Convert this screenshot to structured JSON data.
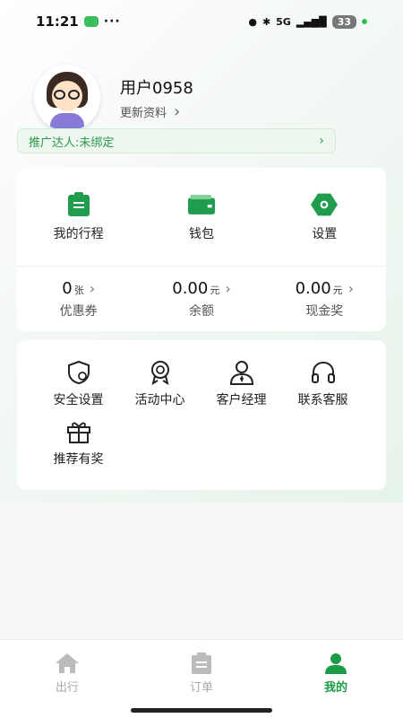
{
  "status_bar": {
    "time": "11:21",
    "dots": "···",
    "network": "5G",
    "battery": "33"
  },
  "profile": {
    "username": "用户0958",
    "edit_label": "更新资料",
    "avatar_icon": "user-avatar"
  },
  "promo": {
    "label": "推广达人:未绑定"
  },
  "quick_actions": [
    {
      "label": "我的行程",
      "icon": "clipboard-icon"
    },
    {
      "label": "钱包",
      "icon": "wallet-icon"
    },
    {
      "label": "设置",
      "icon": "gear-icon"
    }
  ],
  "stats": [
    {
      "value": "0",
      "unit": "张",
      "label": "优惠券"
    },
    {
      "value": "0.00",
      "unit": "元",
      "label": "余额"
    },
    {
      "value": "0.00",
      "unit": "元",
      "label": "现金奖"
    }
  ],
  "services": [
    {
      "label": "安全设置",
      "icon": "shield-gear-icon"
    },
    {
      "label": "活动中心",
      "icon": "medal-icon"
    },
    {
      "label": "客户经理",
      "icon": "manager-icon"
    },
    {
      "label": "联系客服",
      "icon": "headset-icon"
    },
    {
      "label": "推荐有奖",
      "icon": "gift-icon"
    }
  ],
  "tabbar": [
    {
      "label": "出行",
      "icon": "home-icon",
      "active": false
    },
    {
      "label": "订单",
      "icon": "orders-icon",
      "active": false
    },
    {
      "label": "我的",
      "icon": "person-icon",
      "active": true
    }
  ],
  "colors": {
    "accent": "#1a9b46",
    "promo_text": "#2c9a4a"
  }
}
